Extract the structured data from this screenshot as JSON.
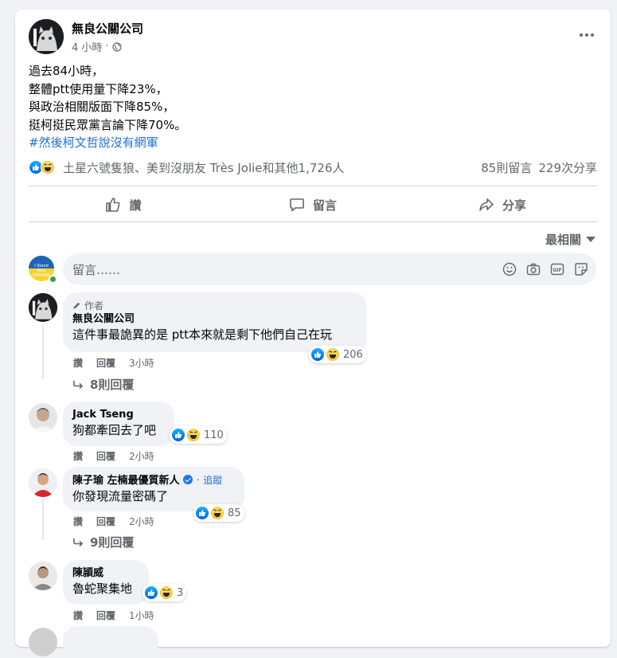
{
  "post": {
    "page_name": "無良公關公司",
    "time": "4 小時",
    "lines": [
      "過去84小時，",
      "整體ptt使用量下降23%，",
      "與政治相關版面下降85%，",
      "挺柯挺民眾黨言論下降70%。"
    ],
    "hashtag": "#然後柯文哲說沒有網軍"
  },
  "reactions": {
    "names": "土星六號隻狼、美到沒朋友 Très Jolie和其他1,726人",
    "comments": "85則留言",
    "shares": "229次分享"
  },
  "actions": {
    "like": "讚",
    "comment": "留言",
    "share": "分享"
  },
  "sort_label": "最相關",
  "composer": {
    "placeholder": "留言……",
    "avatar_text": "I Stand With UKRAINE"
  },
  "comments": [
    {
      "author_tag": "作者",
      "name": "無良公關公司",
      "text": "這件事最詭異的是 ptt本來就是剩下他們自己在玩",
      "count": "206",
      "like": "讚",
      "reply": "回覆",
      "time": "3小時",
      "replies": "8則回覆"
    },
    {
      "name": "Jack Tseng",
      "text": "狗都牽回去了吧",
      "count": "110",
      "like": "讚",
      "reply": "回覆",
      "time": "2小時"
    },
    {
      "name": "陳子瑜 左楠最優質新人",
      "follow": "追蹤",
      "text": "你發現流量密碼了",
      "count": "85",
      "like": "讚",
      "reply": "回覆",
      "time": "2小時",
      "replies": "9則回覆"
    },
    {
      "name": "陳頴威",
      "text": "魯蛇聚集地",
      "count": "3",
      "like": "讚",
      "reply": "回覆",
      "time": "1小時"
    }
  ],
  "colors": {
    "accent": "#216fdb",
    "secondary_text": "#65676b",
    "bubble": "#f0f2f5"
  }
}
